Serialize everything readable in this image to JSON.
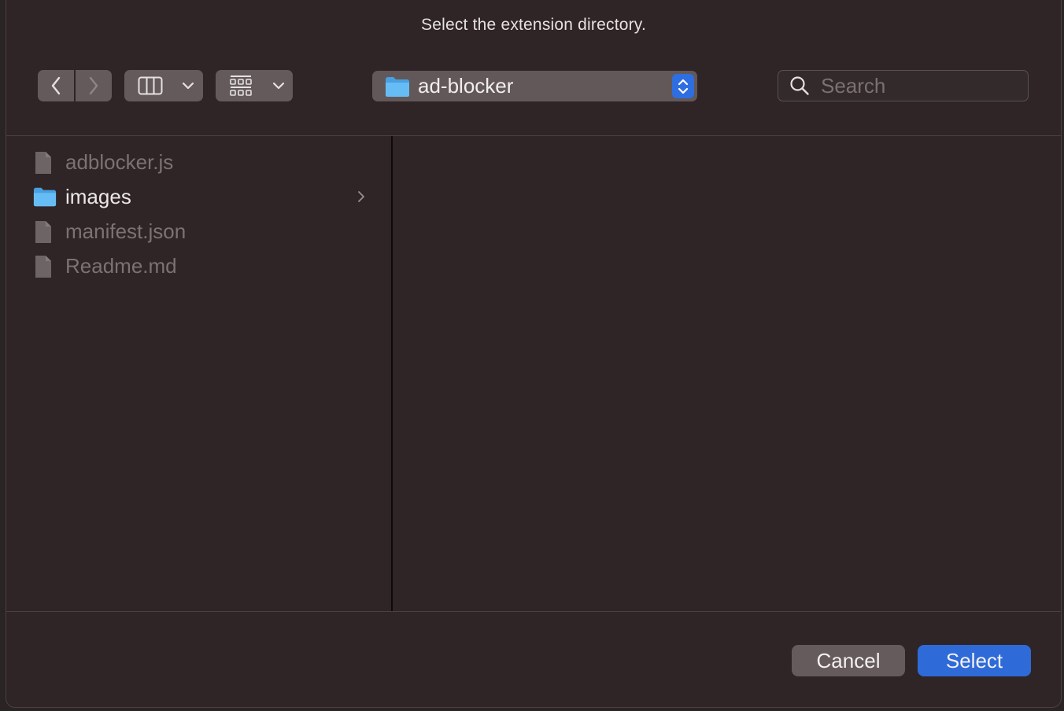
{
  "dialog": {
    "title": "Select the extension directory."
  },
  "toolbar": {
    "back_icon": "chevron-left-icon",
    "forward_icon": "chevron-right-icon",
    "view_mode_icon": "columns-view-icon",
    "group_icon": "grid-group-icon",
    "location": {
      "label": "ad-blocker",
      "icon": "folder-icon"
    },
    "search": {
      "placeholder": "Search",
      "value": ""
    }
  },
  "browser": {
    "items": [
      {
        "name": "adblocker.js",
        "kind": "file",
        "enabled": false
      },
      {
        "name": "images",
        "kind": "folder",
        "enabled": true
      },
      {
        "name": "manifest.json",
        "kind": "file",
        "enabled": false
      },
      {
        "name": "Readme.md",
        "kind": "file",
        "enabled": false
      }
    ]
  },
  "footer": {
    "cancel_label": "Cancel",
    "select_label": "Select"
  },
  "colors": {
    "background": "#2f2526",
    "control": "#645a5b",
    "accent": "#2e6bd9",
    "folder": "#5bb4f0",
    "disabled_text": "#7c7273"
  }
}
